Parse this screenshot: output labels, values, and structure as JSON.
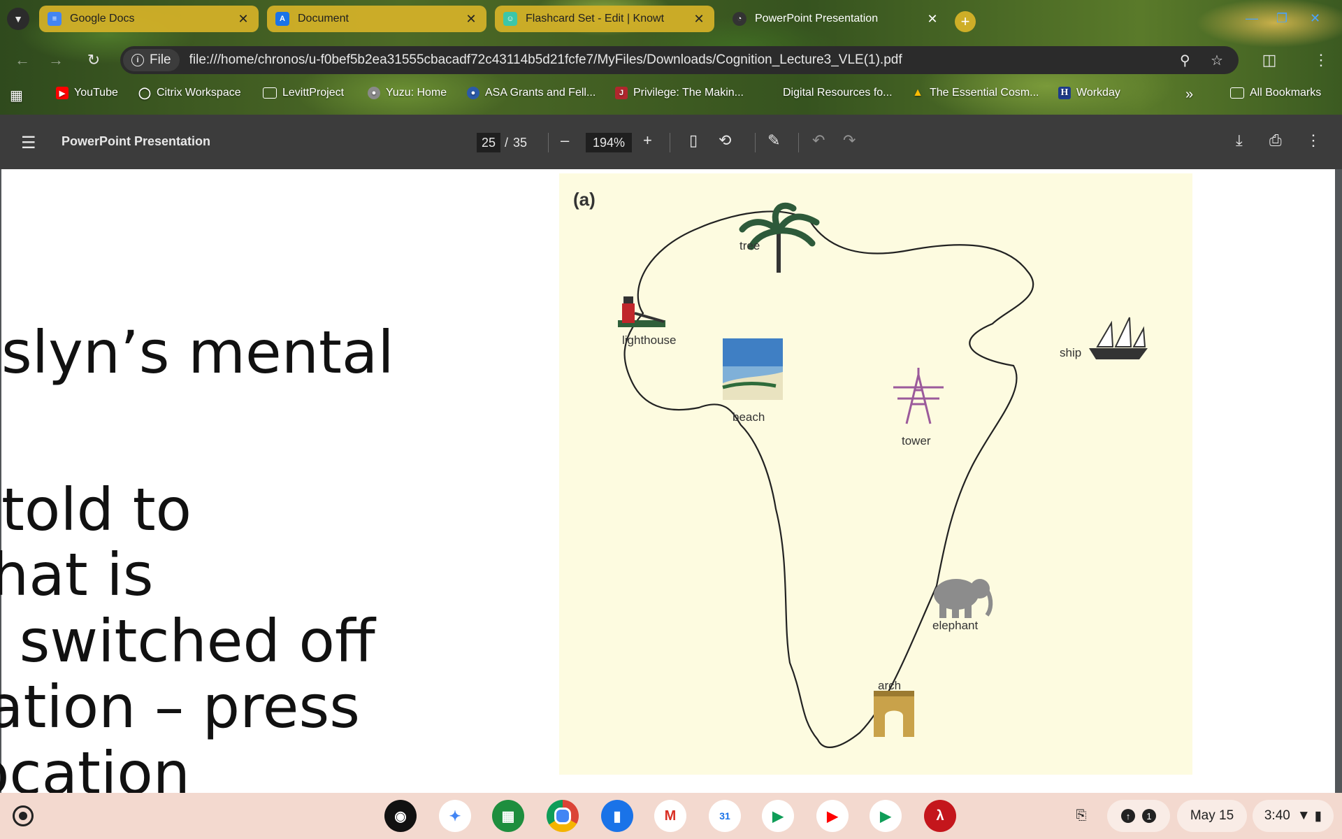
{
  "tabs": [
    {
      "title": "Google Docs",
      "favicon": "docs-icon",
      "active": false
    },
    {
      "title": "Document",
      "favicon": "document-icon",
      "active": false
    },
    {
      "title": "Flashcard Set - Edit | Knowt",
      "favicon": "knowt-icon",
      "active": false
    },
    {
      "title": "PowerPoint Presentation",
      "favicon": "pdf-icon",
      "active": true
    }
  ],
  "omnibox": {
    "scheme_label": "File",
    "url": "file:///home/chronos/u-f0bef5b2ea31555cbacadf72c43114b5d21fcfe7/MyFiles/Downloads/Cognition_Lecture3_VLE(1).pdf"
  },
  "bookmarks": [
    {
      "label": "YouTube",
      "icon": "youtube-icon"
    },
    {
      "label": "Citrix Workspace",
      "icon": "citrix-icon"
    },
    {
      "label": "LevittProject",
      "icon": "folder-icon"
    },
    {
      "label": "Yuzu: Home",
      "icon": "globe-icon"
    },
    {
      "label": "ASA Grants and Fell...",
      "icon": "asa-icon"
    },
    {
      "label": "Privilege: The Makin...",
      "icon": "book-icon"
    },
    {
      "label": "Digital Resources fo...",
      "icon": "none"
    },
    {
      "label": "The Essential Cosm...",
      "icon": "drive-icon"
    },
    {
      "label": "Workday",
      "icon": "workday-icon"
    },
    {
      "label": "All Bookmarks",
      "icon": "folder-icon"
    }
  ],
  "pdf": {
    "title": "PowerPoint Presentation",
    "current_page": "25",
    "separator": "/",
    "total_pages": "35",
    "zoom": "194%"
  },
  "slide": {
    "lines": [
      "slyn’s mental",
      "told to",
      "hat is",
      "t switched off",
      "ation – press",
      "ocation"
    ]
  },
  "figure": {
    "panel_label": "(a)",
    "landmarks": [
      "tree",
      "lighthouse",
      "beach",
      "ship",
      "tower",
      "elephant",
      "arch"
    ]
  },
  "shelf": {
    "apps": [
      "podcasts-icon",
      "gemini-icon",
      "app-grid-icon",
      "chrome-icon",
      "files-icon",
      "gmail-icon",
      "calendar-icon",
      "meet-icon",
      "youtube-icon",
      "play-store-icon",
      "acrobat-icon"
    ],
    "calendar_day": "31",
    "notification_count": "1",
    "date": "May 15",
    "time": "3:40"
  }
}
